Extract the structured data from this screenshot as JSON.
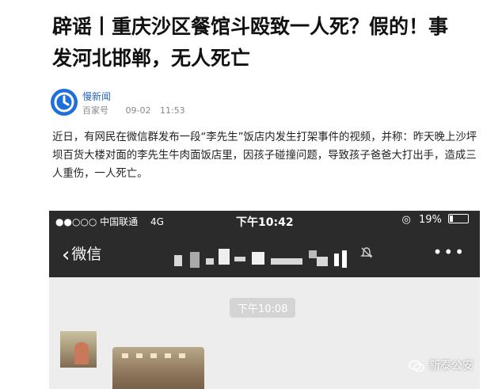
{
  "article": {
    "headline": "辟谣丨重庆沙区餐馆斗殴致一人死？假的！事发河北邯郸，无人死亡",
    "source": {
      "name": "慢新闻",
      "platform": "百家号",
      "date": "09-02",
      "time": "11:53",
      "brand_color": "#1e6fd9"
    },
    "paragraph": "近日，有网民在微信群发布一段“李先生”饭店内发生打架事件的视频，并称：昨天晚上沙坪坝百货大楼对面的李先生牛肉面饭店里，因孩子碰撞问题，导致孩子爸爸大打出手，造成三人重伤，一人死亡。"
  },
  "screenshot": {
    "statusbar": {
      "carrier": "●●○○○ 中国联通",
      "network": "4G",
      "time": "下午10:42",
      "battery": "19%"
    },
    "navbar": {
      "back_label": "微信",
      "more_icon": "more-icon",
      "mute_icon": "mute-icon"
    },
    "chat": {
      "timestamp": "下午10:08"
    },
    "watermark": "新泰公安"
  }
}
